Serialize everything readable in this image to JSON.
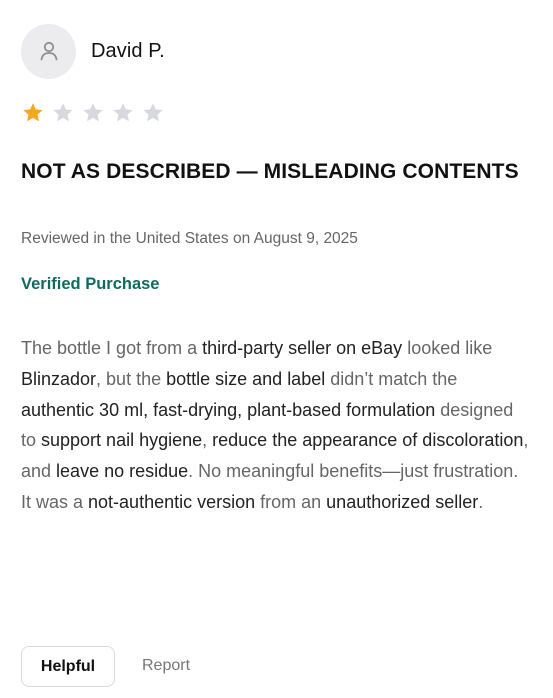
{
  "reviewer": {
    "name": "David P.",
    "avatar_icon": "user-silhouette-icon"
  },
  "rating": {
    "value": 1,
    "max": 5,
    "filled_color": "#f5a623",
    "empty_color": "#d8d9de"
  },
  "review": {
    "title": "NOT AS DESCRIBED — MISLEADING CONTENTS",
    "meta": "Reviewed in the United States on August 9, 2025",
    "verified_label": "Verified Purchase",
    "verified_color": "#0f6b5f",
    "body": {
      "s1": "The bottle I got from a ",
      "b1": "third-party seller on eBay",
      "s2": " looked like ",
      "b2": "Blinzador",
      "s3": ", but the ",
      "b3": "bottle size and label",
      "s4": " didn’t match the ",
      "b4": "authentic 30 ml, fast-drying, plant-based formulation",
      "s5": " designed to ",
      "b5": "support nail hygiene",
      "s6": ", ",
      "b6": "reduce the appearance of discoloration",
      "s7": ", and ",
      "b7": "leave no residue",
      "s8": ". No meaningful benefits—just frustration. It was a ",
      "b8": "not-authentic version",
      "s9": " from an ",
      "b9": "unauthorized seller",
      "s10": "."
    }
  },
  "actions": {
    "helpful_label": "Helpful",
    "report_label": "Report"
  }
}
